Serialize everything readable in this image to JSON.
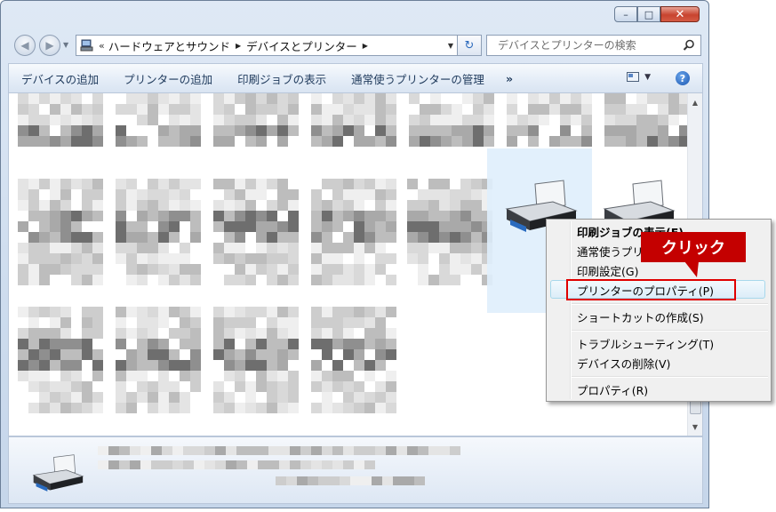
{
  "window": {
    "caption": {
      "minimize": "–",
      "maximize": "□",
      "close": "✕"
    }
  },
  "address_bar": {
    "overflow": "«",
    "crumbs": [
      "ハードウェアとサウンド",
      "デバイスとプリンター"
    ]
  },
  "search": {
    "placeholder": "デバイスとプリンターの検索"
  },
  "commands": {
    "add_device": "デバイスの追加",
    "add_printer": "プリンターの追加",
    "see_print_jobs": "印刷ジョブの表示",
    "set_default": "通常使うプリンターの管理",
    "more": "»"
  },
  "context_menu": {
    "items": [
      "印刷ジョブの表示(E)",
      "通常使うプリンターに設定(A)",
      "印刷設定(G)",
      "プリンターのプロパティ(P)",
      "ショートカットの作成(S)",
      "トラブルシューティング(T)",
      "デバイスの削除(V)",
      "プロパティ(R)"
    ]
  },
  "annotation": {
    "callout": "クリック"
  },
  "colors": {
    "highlight": "#e00000",
    "callout": "#c40000",
    "hover": "#dcedf8"
  }
}
